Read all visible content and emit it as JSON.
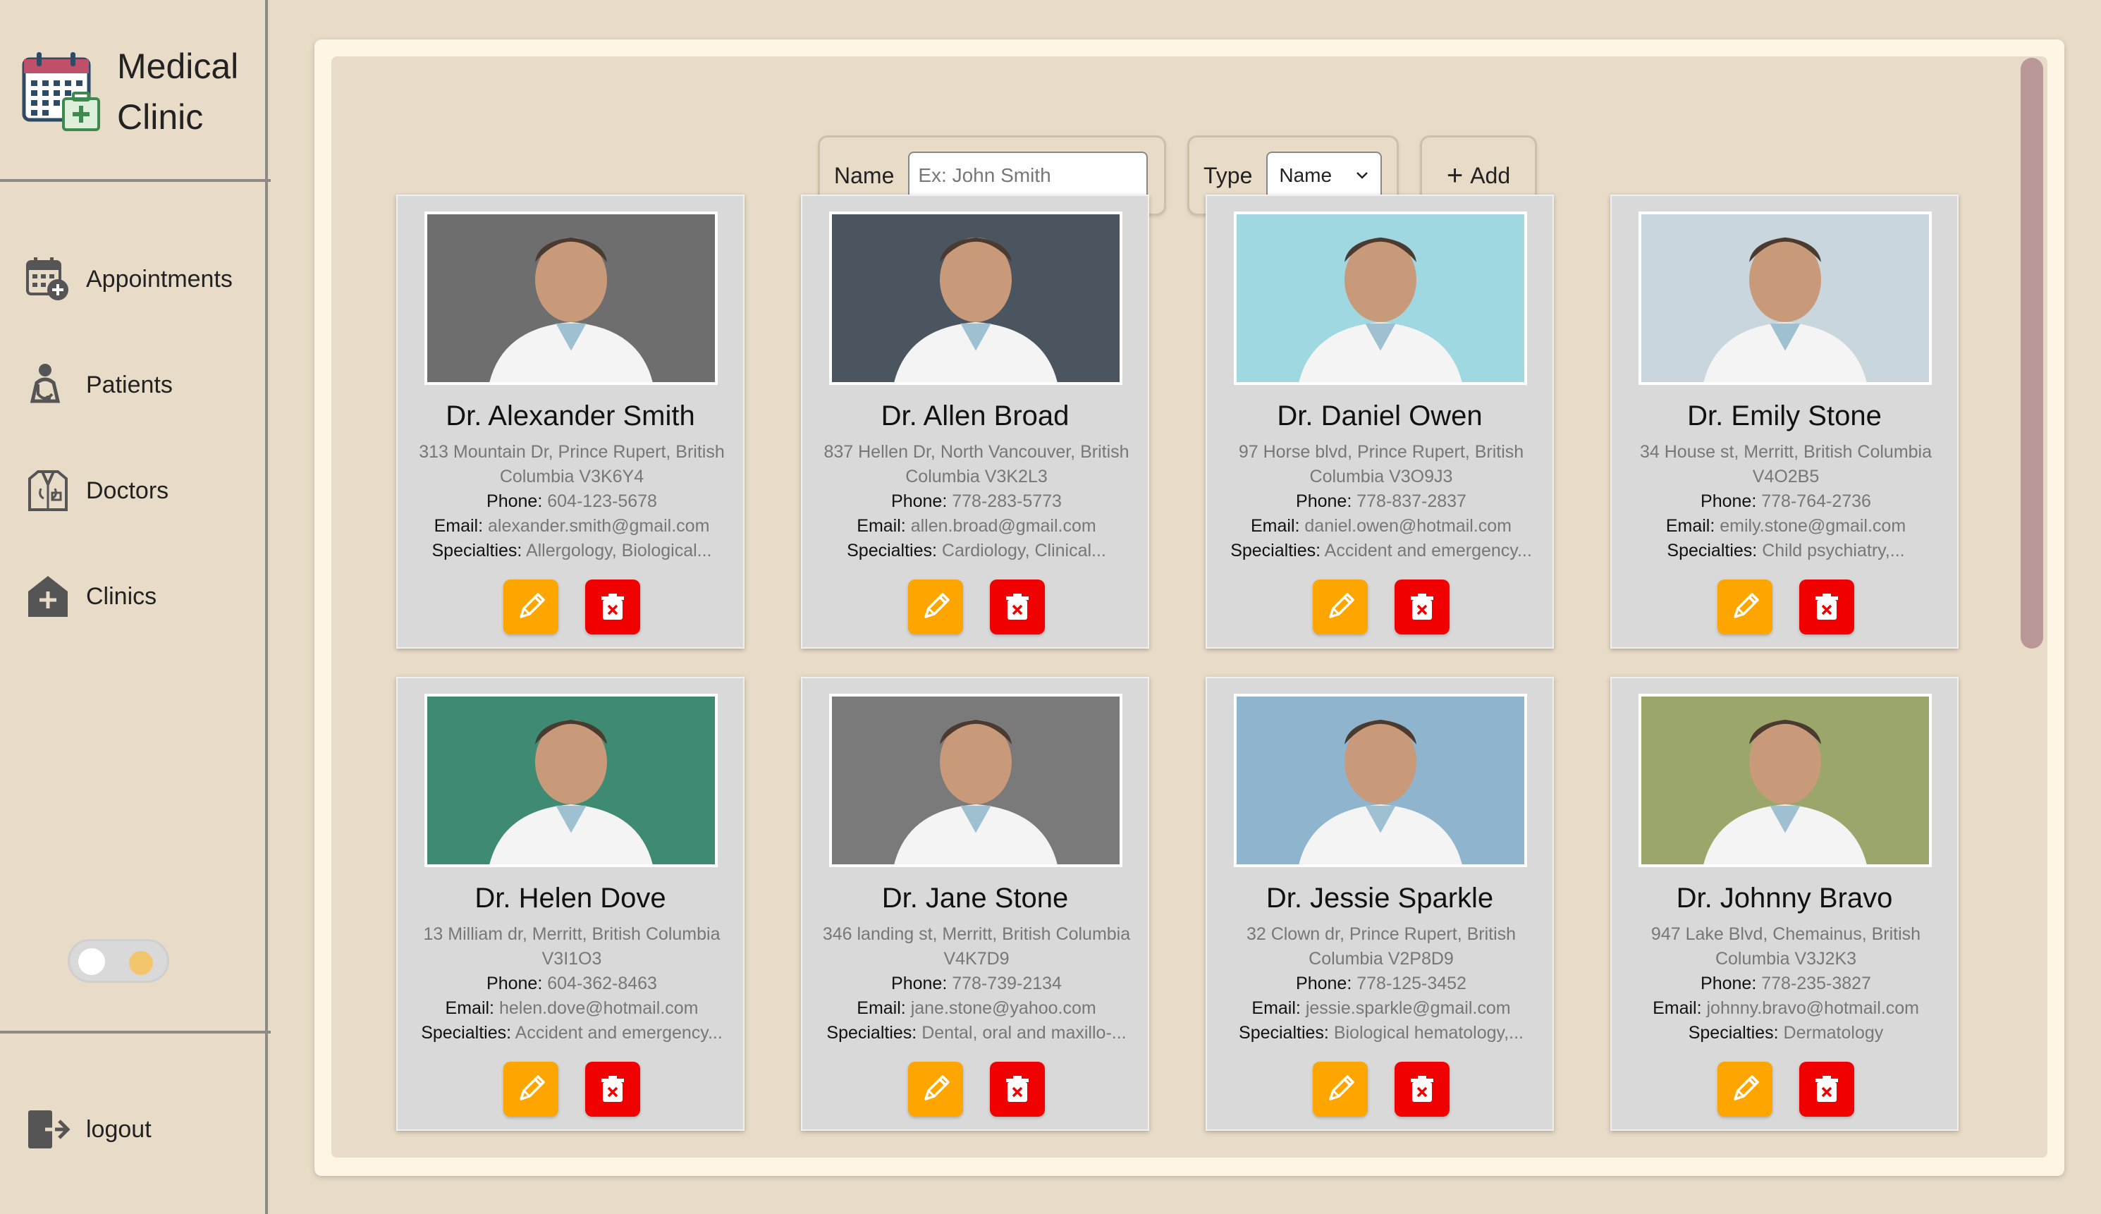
{
  "brand": {
    "line1": "Medical",
    "line2": "Clinic",
    "icon": "calendar-clinic-icon"
  },
  "nav": [
    {
      "label": "Appointments",
      "icon": "calendar-add-icon"
    },
    {
      "label": "Patients",
      "icon": "patient-icon"
    },
    {
      "label": "Doctors",
      "icon": "doctor-coat-icon"
    },
    {
      "label": "Clinics",
      "icon": "clinic-house-icon"
    }
  ],
  "logout": {
    "label": "logout",
    "icon": "logout-icon"
  },
  "filters": {
    "name_label": "Name",
    "name_placeholder": "Ex: John Smith",
    "type_label": "Type",
    "type_value": "Name",
    "add_label": "Add"
  },
  "colors": {
    "background": "#E8DCC8",
    "edit": "#FFA500",
    "delete": "#F00000",
    "scrollbar": "#BA9898"
  },
  "field_labels": {
    "phone": "Phone:",
    "email": "Email:",
    "specialties": "Specialties:"
  },
  "doctors": [
    {
      "name": "Dr. Alexander Smith",
      "address1": "313 Mountain Dr, Prince Rupert, British",
      "address2": "Columbia V3K6Y4",
      "phone": "604-123-5678",
      "email": "alexander.smith@gmail.com",
      "specialties": "Allergology, Biological...",
      "photo_bg": "#6E6E6E"
    },
    {
      "name": "Dr. Allen Broad",
      "address1": "837 Hellen Dr, North Vancouver, British",
      "address2": "Columbia V3K2L3",
      "phone": "778-283-5773",
      "email": "allen.broad@gmail.com",
      "specialties": "Cardiology, Clinical...",
      "photo_bg": "#4A5560"
    },
    {
      "name": "Dr. Daniel Owen",
      "address1": "97 Horse blvd, Prince Rupert, British",
      "address2": "Columbia V3O9J3",
      "phone": "778-837-2837",
      "email": "daniel.owen@hotmail.com",
      "specialties": "Accident and emergency...",
      "photo_bg": "#9FD8E0"
    },
    {
      "name": "Dr. Emily Stone",
      "address1": "34 House st, Merritt, British Columbia",
      "address2": "V4O2B5",
      "phone": "778-764-2736",
      "email": "emily.stone@gmail.com",
      "specialties": "Child psychiatry,...",
      "photo_bg": "#C9D6DD"
    },
    {
      "name": "Dr. Helen Dove",
      "address1": "13 Milliam dr, Merritt, British Columbia",
      "address2": "V3I1O3",
      "phone": "604-362-8463",
      "email": "helen.dove@hotmail.com",
      "specialties": "Accident and emergency...",
      "photo_bg": "#3E8A72"
    },
    {
      "name": "Dr. Jane Stone",
      "address1": "346 landing st, Merritt, British Columbia",
      "address2": "V4K7D9",
      "phone": "778-739-2134",
      "email": "jane.stone@yahoo.com",
      "specialties": "Dental, oral and maxillo-...",
      "photo_bg": "#7A7A7A"
    },
    {
      "name": "Dr. Jessie Sparkle",
      "address1": "32 Clown dr, Prince Rupert, British",
      "address2": "Columbia V2P8D9",
      "phone": "778-125-3452",
      "email": "jessie.sparkle@gmail.com",
      "specialties": "Biological hematology,...",
      "photo_bg": "#8FB4CE"
    },
    {
      "name": "Dr. Johnny Bravo",
      "address1": "947 Lake Blvd, Chemainus, British",
      "address2": "Columbia V3J2K3",
      "phone": "778-235-3827",
      "email": "johnny.bravo@hotmail.com",
      "specialties": "Dermatology",
      "photo_bg": "#9AA66A"
    }
  ]
}
